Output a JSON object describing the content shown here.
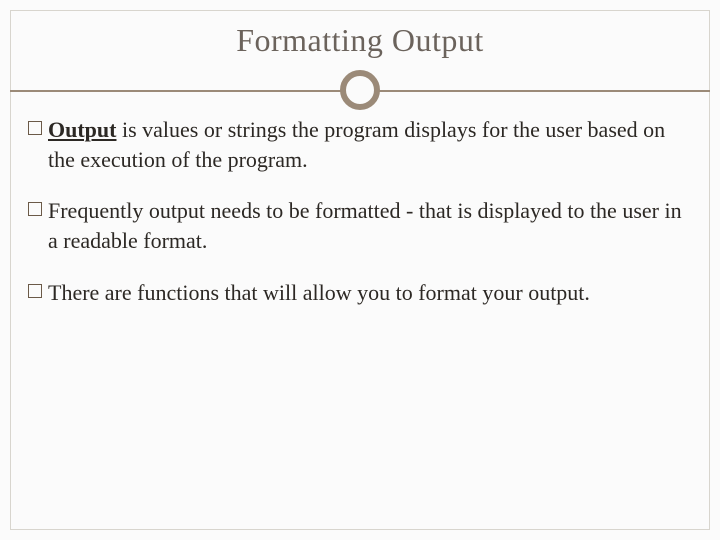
{
  "title": "Formatting Output",
  "bullets": [
    {
      "lead_bold_underline": "Output",
      "rest": " is values or strings the program displays for the user based on the execution of the program."
    },
    {
      "lead_bold_underline": "",
      "rest": "Frequently output needs to be formatted - that is displayed to the user in a readable format."
    },
    {
      "lead_bold_underline": "",
      "rest": "There are functions that will allow you to format your output."
    }
  ]
}
